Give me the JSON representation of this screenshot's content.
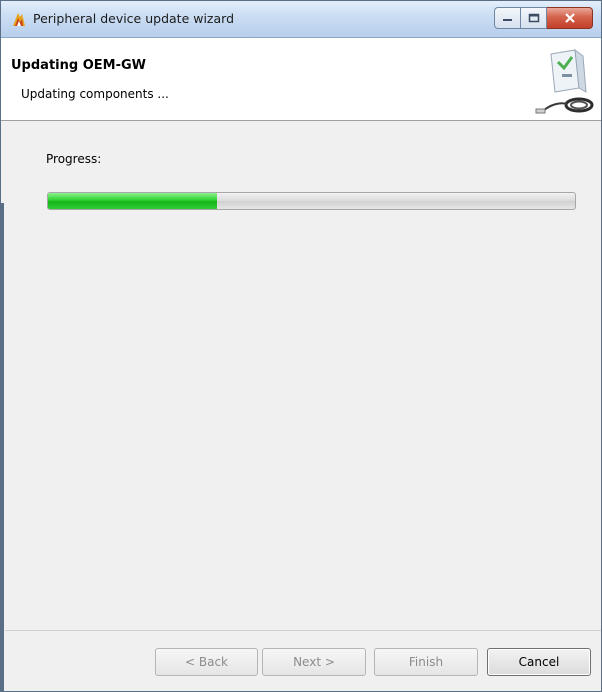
{
  "window": {
    "title": "Peripheral device update wizard",
    "icon": "wizard-flame-icon",
    "controls": [
      "minimize-icon",
      "maximize-icon",
      "close-icon"
    ]
  },
  "header": {
    "title": "Updating OEM-GW",
    "subtitle": "Updating components ...",
    "image": "device-gateway-icon"
  },
  "main": {
    "progress_label": "Progress:",
    "progress_value": 0.32,
    "progress_color": "#2ecc40"
  },
  "footer": {
    "back_label": "< Back",
    "next_label": "Next >",
    "finish_label": "Finish",
    "cancel_label": "Cancel"
  }
}
